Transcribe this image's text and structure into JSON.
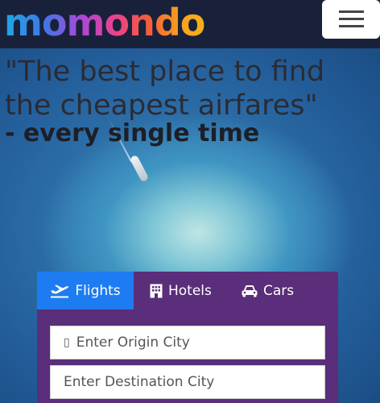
{
  "header": {
    "logo_text": "momondo",
    "menu_icon": "hamburger-menu-icon"
  },
  "hero": {
    "headline": "\"The best place to find the cheapest airfares\"",
    "subline": "- every single time"
  },
  "search": {
    "tabs": [
      {
        "label": "Flights",
        "icon": "airplane-departure-icon",
        "active": true
      },
      {
        "label": "Hotels",
        "icon": "building-icon",
        "active": false
      },
      {
        "label": "Cars",
        "icon": "car-icon",
        "active": false
      }
    ],
    "origin": {
      "placeholder": "Enter Origin City",
      "icon_glyph": "▯"
    },
    "destination": {
      "placeholder": "Enter Destination City"
    }
  },
  "colors": {
    "header_bg": "#19213a",
    "panel_bg": "#5a2e7a",
    "active_tab": "#1d7cf1"
  }
}
